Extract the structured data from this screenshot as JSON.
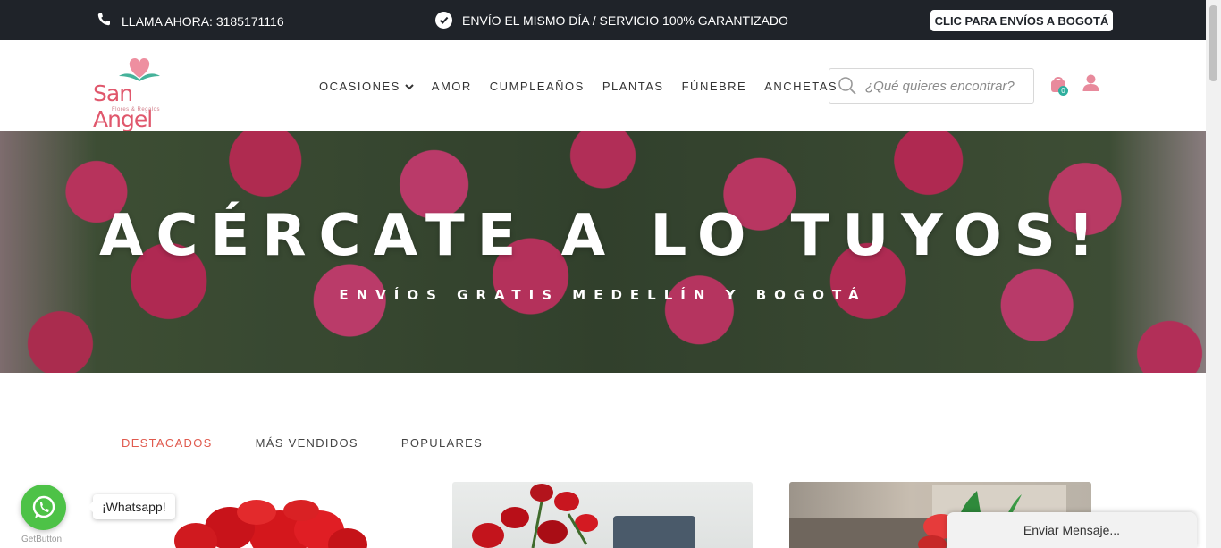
{
  "topbar": {
    "call_text": "LLAMA AHORA: 3185171116",
    "guarantee_text": "ENVÍO EL MISMO DÍA / SERVICIO 100% GARANTIZADO",
    "bogota_button": "CLIC PARA ENVÍOS A BOGOTÁ",
    "bg_color": "#1f2329"
  },
  "header": {
    "logo_text": "San Angel",
    "logo_subtext": "Flores & Regalos",
    "nav": [
      {
        "label": "OCASIONES",
        "has_dropdown": true
      },
      {
        "label": "AMOR"
      },
      {
        "label": "CUMPLEAÑOS"
      },
      {
        "label": "PLANTAS"
      },
      {
        "label": "FÚNEBRE"
      },
      {
        "label": "ANCHETAS"
      }
    ],
    "search_placeholder": "¿Qué quieres encontrar?",
    "cart_count": "0",
    "accent_color": "#e86b86"
  },
  "hero": {
    "title": "ACÉRCATE A LO TUYOS!",
    "subtitle": "ENVÍOS GRATIS MEDELLÍN Y BOGOTÁ"
  },
  "tabs": [
    {
      "label": "DESTACADOS",
      "active": true
    },
    {
      "label": "MÁS VENDIDOS",
      "active": false
    },
    {
      "label": "POPULARES",
      "active": false
    }
  ],
  "whatsapp": {
    "label": "¡Whatsapp!",
    "credit": "GetButton",
    "color": "#4dc247"
  },
  "chat": {
    "label": "Enviar Mensaje..."
  }
}
